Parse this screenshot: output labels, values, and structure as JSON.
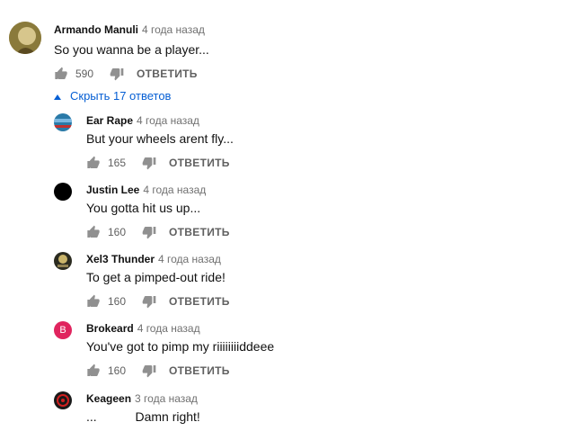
{
  "comments": [
    {
      "author": "Armando Manuli",
      "time": "4 года назад",
      "text": "So you wanna be a player...",
      "likes": "590",
      "reply": "ОТВЕТИТЬ",
      "avatar_color": "#b9a25e"
    },
    {
      "author": "Ear Rape",
      "time": "4 года назад",
      "text": "But your wheels arent fly...",
      "likes": "165",
      "reply": "ОТВЕТИТЬ",
      "avatar_color": "#2a7aa8"
    },
    {
      "author": "Justin Lee",
      "time": "4 года назад",
      "text": "You gotta hit us up...",
      "likes": "160",
      "reply": "ОТВЕТИТЬ",
      "avatar_color": "#000000"
    },
    {
      "author": "Xel3 Thunder",
      "time": "4 года назад",
      "text": "To get a pimped-out ride!",
      "likes": "160",
      "reply": "ОТВЕТИТЬ",
      "avatar_color": "#2b2b20"
    },
    {
      "author": "Brokeard",
      "time": "4 года назад",
      "text": "You've got to pimp my riiiiiiiiddeee",
      "likes": "160",
      "reply": "ОТВЕТИТЬ",
      "avatar_color": "#e0245e",
      "avatar_letter": "B"
    },
    {
      "author": "Keageen",
      "time": "3 года назад",
      "text": "...           Damn right!",
      "likes": "",
      "reply": "",
      "avatar_color": "#1a1a1a"
    }
  ],
  "replies_toggle": {
    "label": "Скрыть 17 ответов",
    "color": "#065fd4"
  }
}
